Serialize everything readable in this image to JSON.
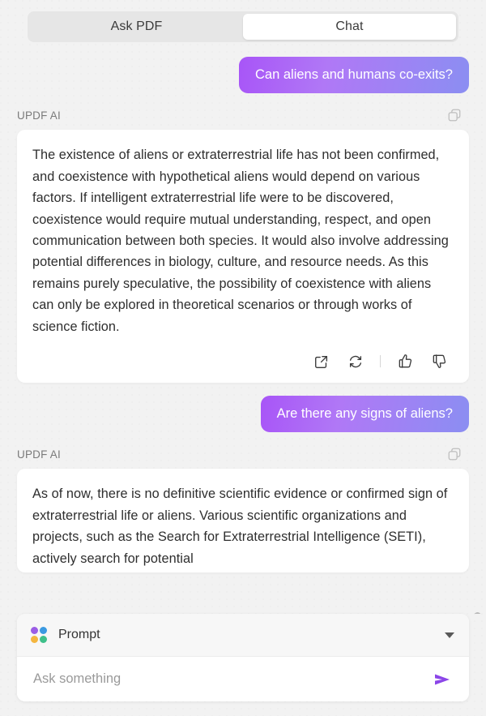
{
  "app": {
    "name": "UPDF AI Chat Panel"
  },
  "colors": {
    "page_background": "#f2f2f2",
    "tab_track": "#e6e6e6",
    "tab_active": "#ffffff",
    "user_bubble_gradient_start": "#a855f7",
    "user_bubble_gradient_end": "#8b8ef2",
    "card": "#ffffff",
    "send_icon": "#8b45e8",
    "dot_purple": "#9b5de5",
    "dot_blue": "#3b9ae1",
    "dot_yellow": "#f4b63f",
    "dot_green": "#3ec08a",
    "scrollbar_thumb": "#b9b9b9",
    "body_text": "#2e2e2e",
    "muted_text": "#7a7a7a"
  },
  "tabs": [
    {
      "id": "ask-pdf",
      "label": "Ask PDF",
      "active": false
    },
    {
      "id": "chat",
      "label": "Chat",
      "active": true
    }
  ],
  "messages": [
    {
      "role": "user",
      "text": "Can aliens and humans co-exits?"
    },
    {
      "role": "assistant",
      "author": "UPDF AI",
      "text": "The existence of aliens or extraterrestrial life has not been confirmed, and coexistence with hypothetical aliens would depend on various factors. If intelligent extraterrestrial life were to be discovered, coexistence would require mutual understanding, respect, and open communication between both species. It would also involve addressing potential differences in biology, culture, and resource needs. As this remains purely speculative, the possibility of coexistence with aliens can only be explored in theoretical scenarios or through works of science fiction.",
      "copy_icon": "copy-icon",
      "actions": [
        {
          "id": "share",
          "icon": "external-link-icon"
        },
        {
          "id": "regenerate",
          "icon": "refresh-icon"
        },
        {
          "id": "separator",
          "icon": "divider"
        },
        {
          "id": "like",
          "icon": "thumbs-up-icon"
        },
        {
          "id": "dislike",
          "icon": "thumbs-down-icon"
        }
      ]
    },
    {
      "role": "user",
      "text": "Are there any signs of aliens?"
    },
    {
      "role": "assistant",
      "author": "UPDF AI",
      "text": "As of now, there is no definitive scientific evidence or confirmed sign of extraterrestrial life or aliens. Various scientific organizations and projects, such as the Search for Extraterrestrial Intelligence (SETI), actively search for potential",
      "copy_icon": "copy-icon",
      "truncated": true
    }
  ],
  "composer": {
    "prompt_icon": "four-dots-icon",
    "prompt_label": "Prompt",
    "chevron_icon": "chevron-down-icon",
    "input_value": "",
    "input_placeholder": "Ask something",
    "send_icon": "send-icon"
  },
  "scrollbar": {
    "present": true
  }
}
